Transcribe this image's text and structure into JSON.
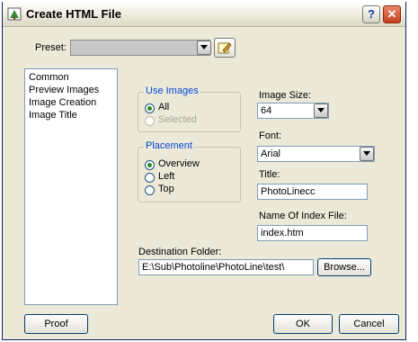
{
  "window": {
    "title": "Create HTML File"
  },
  "titlebar": {
    "help": "?",
    "close": "✕"
  },
  "preset": {
    "label": "Preset:",
    "value": ""
  },
  "sidebar": {
    "items": [
      {
        "label": "Common"
      },
      {
        "label": "Preview Images"
      },
      {
        "label": "Image Creation"
      },
      {
        "label": "Image Title"
      }
    ]
  },
  "use_images": {
    "legend": "Use Images",
    "options": [
      {
        "label": "All",
        "checked": true,
        "enabled": true
      },
      {
        "label": "Selected",
        "checked": false,
        "enabled": false
      }
    ]
  },
  "placement": {
    "legend": "Placement",
    "options": [
      {
        "label": "Overview",
        "checked": true
      },
      {
        "label": "Left",
        "checked": false
      },
      {
        "label": "Top",
        "checked": false
      }
    ]
  },
  "image_size": {
    "label": "Image Size:",
    "value": "64"
  },
  "font": {
    "label": "Font:",
    "value": "Arial"
  },
  "title_field": {
    "label": "Title:",
    "value": "PhotoLinecc"
  },
  "index_file": {
    "label": "Name Of Index File:",
    "value": "index.htm"
  },
  "destination": {
    "label": "Destination Folder:",
    "value": "E:\\Sub\\Photoline\\PhotoLine\\test\\",
    "browse": "Browse..."
  },
  "buttons": {
    "proof": "Proof",
    "ok": "OK",
    "cancel": "Cancel"
  },
  "colors": {
    "accent_legend": "#0046d5",
    "dialog_bg": "#ece9d8",
    "close": "#c6401c"
  },
  "icons": {
    "app": "tree-icon",
    "preset_edit": "pencil-icon",
    "dropdown": "chevron-down-icon"
  }
}
